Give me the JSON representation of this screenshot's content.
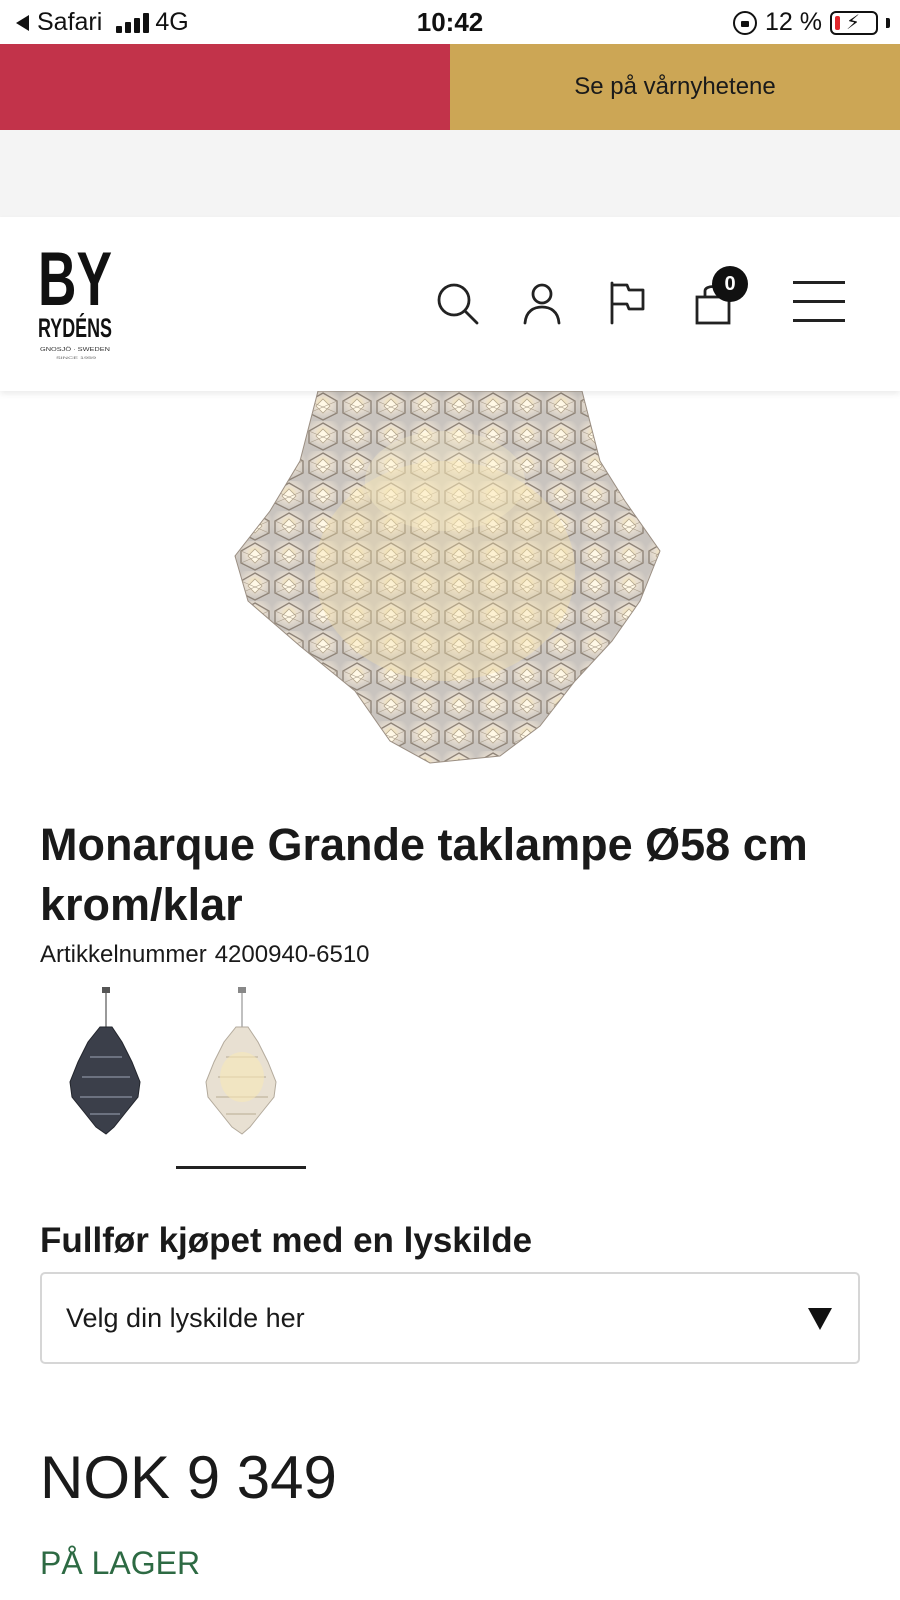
{
  "status_bar": {
    "back_app": "Safari",
    "network": "4G",
    "time": "10:42",
    "battery_percent": "12 %",
    "battery_level": 0.12
  },
  "promo": {
    "right_label": "Se på vårnyhetene",
    "colors": {
      "left": "#c2334a",
      "right": "#cca655"
    }
  },
  "header": {
    "logo": {
      "line1": "BY",
      "line2": "RYDÉNS",
      "tagline": "GNOSJÖ · SWEDEN",
      "since": "SINCE 1959"
    },
    "icons": [
      "search-icon",
      "account-icon",
      "flag-icon",
      "bag-icon",
      "menu-icon"
    ],
    "cart_count": "0"
  },
  "product": {
    "title": "Monarque Grande taklampe Ø58 cm krom/klar",
    "sku_label": "Artikkelnummer",
    "sku_value": "4200940-6510",
    "variants": [
      {
        "name": "dark-smoke",
        "selected": false
      },
      {
        "name": "clear",
        "selected": true
      }
    ],
    "light_source_heading": "Fullfør kjøpet med en lyskilde",
    "light_source_placeholder": "Velg din lyskilde her",
    "price": "NOK 9 349",
    "stock_status": "PÅ LAGER",
    "stock_color": "#2d6a43"
  }
}
